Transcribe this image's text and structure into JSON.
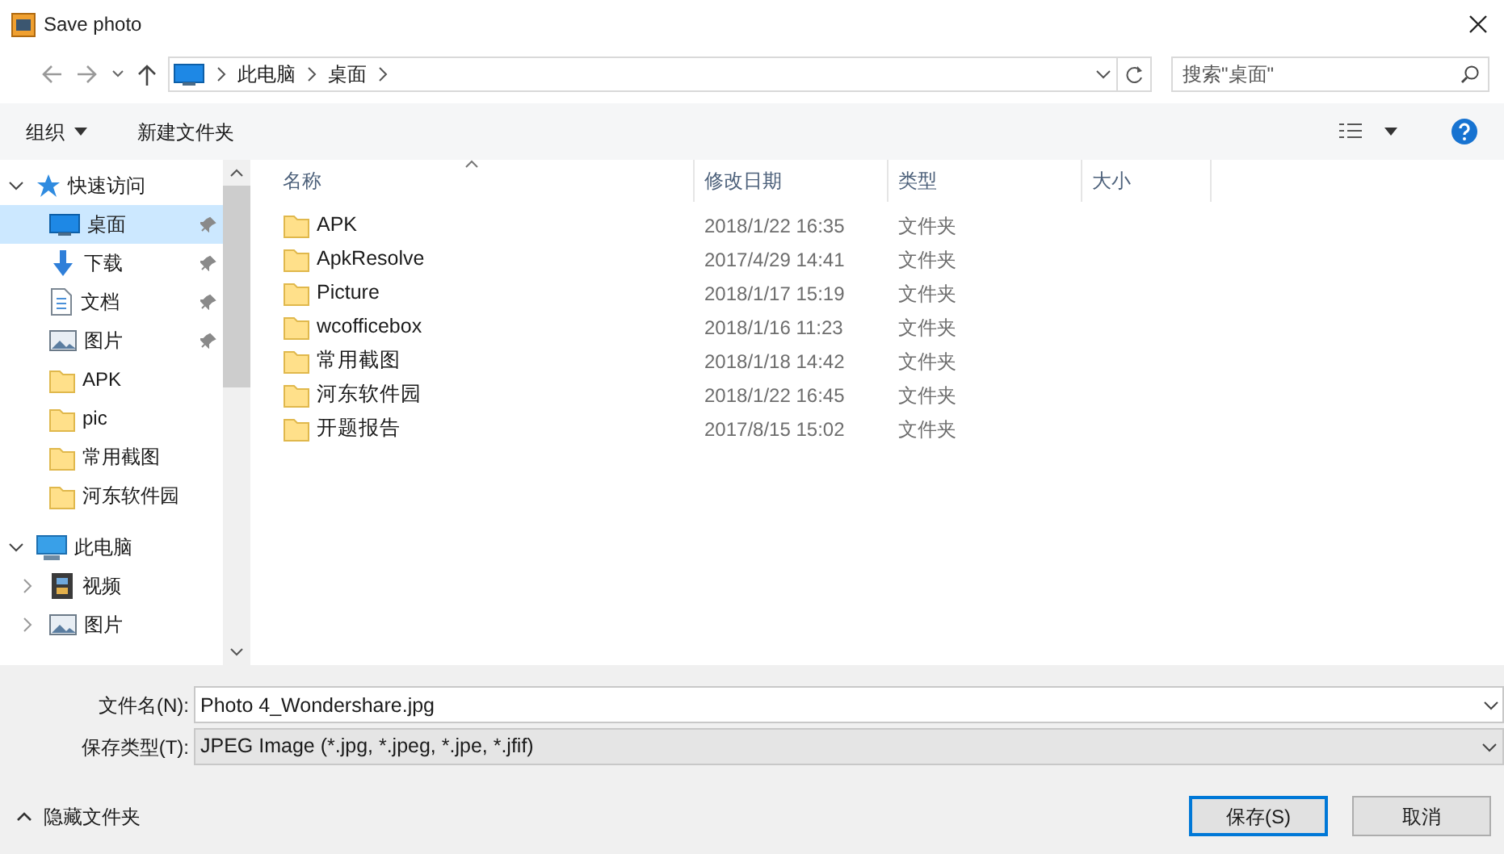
{
  "window": {
    "title": "Save photo"
  },
  "address": {
    "crumbs": [
      "此电脑",
      "桌面"
    ],
    "search_placeholder": "搜索\"桌面\""
  },
  "toolbar": {
    "organize": "组织",
    "new_folder": "新建文件夹"
  },
  "sidebar": {
    "items": [
      {
        "label": "快速访问",
        "kind": "quick",
        "expanded": true,
        "selected": false,
        "children": [
          {
            "label": "桌面",
            "kind": "desktop",
            "pinned": true,
            "selected": true
          },
          {
            "label": "下载",
            "kind": "download",
            "pinned": true,
            "selected": false
          },
          {
            "label": "文档",
            "kind": "document",
            "pinned": true,
            "selected": false
          },
          {
            "label": "图片",
            "kind": "pictures",
            "pinned": true,
            "selected": false
          },
          {
            "label": "APK",
            "kind": "folder",
            "pinned": false,
            "selected": false
          },
          {
            "label": "pic",
            "kind": "folder",
            "pinned": false,
            "selected": false
          },
          {
            "label": "常用截图",
            "kind": "folder",
            "pinned": false,
            "selected": false
          },
          {
            "label": "河东软件园",
            "kind": "folder",
            "pinned": false,
            "selected": false
          }
        ]
      },
      {
        "label": "此电脑",
        "kind": "pc",
        "expanded": true,
        "selected": false,
        "children": [
          {
            "label": "视频",
            "kind": "video",
            "expanded": false,
            "selected": false
          },
          {
            "label": "图片",
            "kind": "pictures",
            "expanded": false,
            "selected": false
          }
        ]
      }
    ]
  },
  "table": {
    "columns": [
      {
        "label": "名称",
        "sorted": true
      },
      {
        "label": "修改日期",
        "sorted": false
      },
      {
        "label": "类型",
        "sorted": false
      },
      {
        "label": "大小",
        "sorted": false
      }
    ],
    "rows": [
      {
        "name": "APK",
        "modified": "2018/1/22 16:35",
        "type": "文件夹"
      },
      {
        "name": "ApkResolve",
        "modified": "2017/4/29 14:41",
        "type": "文件夹"
      },
      {
        "name": "Picture",
        "modified": "2018/1/17 15:19",
        "type": "文件夹"
      },
      {
        "name": "wcofficebox",
        "modified": "2018/1/16 11:23",
        "type": "文件夹"
      },
      {
        "name": "常用截图",
        "modified": "2018/1/18 14:42",
        "type": "文件夹"
      },
      {
        "name": "河东软件园",
        "modified": "2018/1/22 16:45",
        "type": "文件夹"
      },
      {
        "name": "开题报告",
        "modified": "2017/8/15 15:02",
        "type": "文件夹"
      }
    ]
  },
  "form": {
    "filename_label": "文件名(N):",
    "filename": "Photo 4_Wondershare.jpg",
    "type_label": "保存类型(T):",
    "type": "JPEG Image (*.jpg, *.jpeg, *.jpe, *.jfif)"
  },
  "footer": {
    "hide_folders": "隐藏文件夹",
    "buttons": [
      {
        "label": "保存(S)",
        "primary": true
      },
      {
        "label": "取消",
        "primary": false
      }
    ]
  }
}
